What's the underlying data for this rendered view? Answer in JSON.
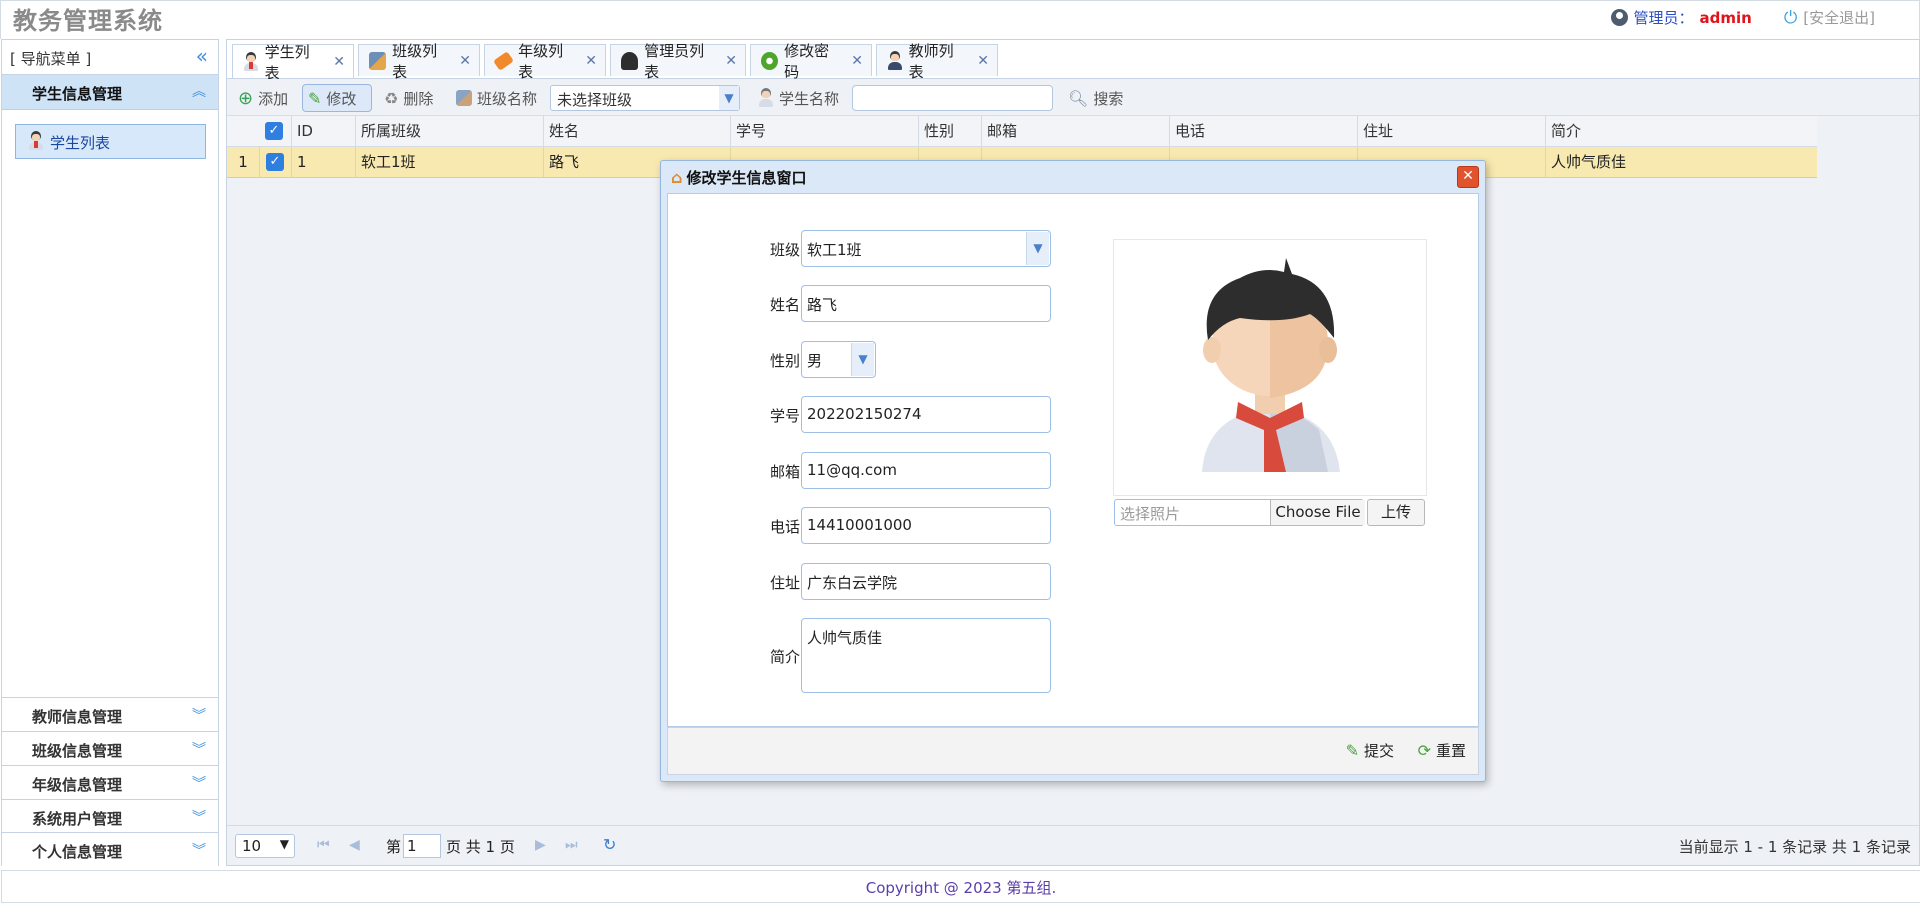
{
  "app": {
    "title": "教务管理系统"
  },
  "header": {
    "admin_label": "管理员：",
    "admin_name": "admin",
    "logout": "[安全退出]"
  },
  "sidebar": {
    "title": "[ 导航菜单 ]",
    "active_group": "学生信息管理",
    "active_item": "学生列表",
    "groups": [
      {
        "label": "教师信息管理"
      },
      {
        "label": "班级信息管理"
      },
      {
        "label": "年级信息管理"
      },
      {
        "label": "系统用户管理"
      },
      {
        "label": "个人信息管理"
      }
    ]
  },
  "tabs": [
    {
      "label": "学生列表",
      "icon": "student-icon"
    },
    {
      "label": "班级列表",
      "icon": "class-icon"
    },
    {
      "label": "年级列表",
      "icon": "tag-icon"
    },
    {
      "label": "管理员列表",
      "icon": "admin-icon"
    },
    {
      "label": "修改密码",
      "icon": "gear-icon"
    },
    {
      "label": "教师列表",
      "icon": "teacher-icon"
    }
  ],
  "toolbar": {
    "add": "添加",
    "edit": "修改",
    "delete": "删除",
    "class_name_label": "班级名称",
    "class_select": "未选择班级",
    "student_name_label": "学生名称",
    "search": "搜索"
  },
  "grid": {
    "columns": [
      "ID",
      "所属班级",
      "姓名",
      "学号",
      "性别",
      "邮箱",
      "电话",
      "住址",
      "简介"
    ],
    "row": {
      "index": "1",
      "id": "1",
      "class": "软工1班",
      "name": "路飞",
      "intro": "人帅气质佳"
    }
  },
  "dialog": {
    "title": "修改学生信息窗口",
    "fields": {
      "class_label": "班级",
      "class_value": "软工1班",
      "name_label": "姓名",
      "name_value": "路飞",
      "gender_label": "性别",
      "gender_value": "男",
      "sno_label": "学号",
      "sno_value": "202202150274",
      "email_label": "邮箱",
      "email_value": "11@qq.com",
      "phone_label": "电话",
      "phone_value": "14410001000",
      "address_label": "住址",
      "address_value": "广东白云学院",
      "intro_label": "简介",
      "intro_value": "人帅气质佳"
    },
    "photo_placeholder": "选择照片",
    "choose_file": "Choose File",
    "upload": "上传",
    "submit": "提交",
    "reset": "重置"
  },
  "pager": {
    "page_size": "10",
    "page_prefix": "第",
    "page_value": "1",
    "page_suffix": "页 共 1 页",
    "summary": "当前显示 1 - 1 条记录 共 1 条记录"
  },
  "footer": {
    "copyright": "Copyright @ 2023 第五组."
  }
}
